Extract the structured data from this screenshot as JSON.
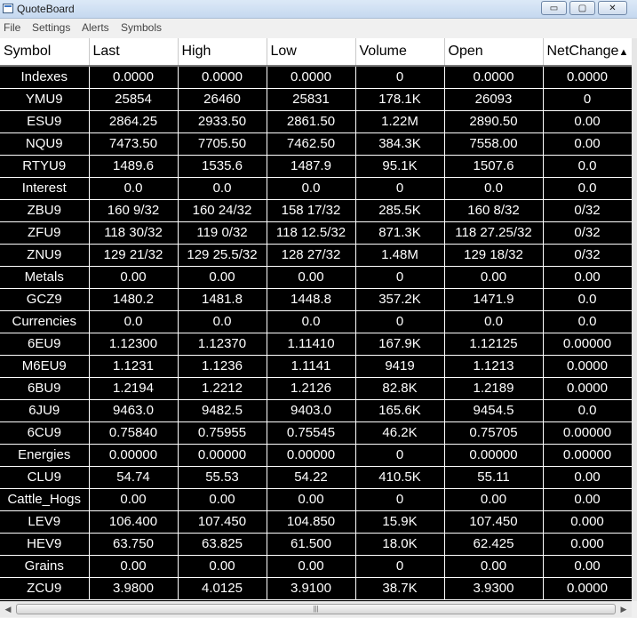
{
  "window": {
    "title": "QuoteBoard",
    "min_glyph": "▭",
    "max_glyph": "▢",
    "close_glyph": "✕"
  },
  "menu": [
    "File",
    "Settings",
    "Alerts",
    "Symbols"
  ],
  "table": {
    "columns": [
      "Symbol",
      "Last",
      "High",
      "Low",
      "Volume",
      "Open",
      "NetChange"
    ],
    "sort_indicator": "▲",
    "rows": [
      [
        "Indexes",
        "0.0000",
        "0.0000",
        "0.0000",
        "0",
        "0.0000",
        "0.0000"
      ],
      [
        "YMU9",
        "25854",
        "26460",
        "25831",
        "178.1K",
        "26093",
        "0"
      ],
      [
        "ESU9",
        "2864.25",
        "2933.50",
        "2861.50",
        "1.22M",
        "2890.50",
        "0.00"
      ],
      [
        "NQU9",
        "7473.50",
        "7705.50",
        "7462.50",
        "384.3K",
        "7558.00",
        "0.00"
      ],
      [
        "RTYU9",
        "1489.6",
        "1535.6",
        "1487.9",
        "95.1K",
        "1507.6",
        "0.0"
      ],
      [
        "Interest",
        "0.0",
        "0.0",
        "0.0",
        "0",
        "0.0",
        "0.0"
      ],
      [
        "ZBU9",
        "160 9/32",
        "160 24/32",
        "158 17/32",
        "285.5K",
        "160 8/32",
        "0/32"
      ],
      [
        "ZFU9",
        "118 30/32",
        "119 0/32",
        "118 12.5/32",
        "871.3K",
        "118 27.25/32",
        "0/32"
      ],
      [
        "ZNU9",
        "129 21/32",
        "129 25.5/32",
        "128 27/32",
        "1.48M",
        "129 18/32",
        "0/32"
      ],
      [
        "Metals",
        "0.00",
        "0.00",
        "0.00",
        "0",
        "0.00",
        "0.00"
      ],
      [
        "GCZ9",
        "1480.2",
        "1481.8",
        "1448.8",
        "357.2K",
        "1471.9",
        "0.0"
      ],
      [
        "Currencies",
        "0.0",
        "0.0",
        "0.0",
        "0",
        "0.0",
        "0.0"
      ],
      [
        "6EU9",
        "1.12300",
        "1.12370",
        "1.11410",
        "167.9K",
        "1.12125",
        "0.00000"
      ],
      [
        "M6EU9",
        "1.1231",
        "1.1236",
        "1.1141",
        "9419",
        "1.1213",
        "0.0000"
      ],
      [
        "6BU9",
        "1.2194",
        "1.2212",
        "1.2126",
        "82.8K",
        "1.2189",
        "0.0000"
      ],
      [
        "6JU9",
        "9463.0",
        "9482.5",
        "9403.0",
        "165.6K",
        "9454.5",
        "0.0"
      ],
      [
        "6CU9",
        "0.75840",
        "0.75955",
        "0.75545",
        "46.2K",
        "0.75705",
        "0.00000"
      ],
      [
        "Energies",
        "0.00000",
        "0.00000",
        "0.00000",
        "0",
        "0.00000",
        "0.00000"
      ],
      [
        "CLU9",
        "54.74",
        "55.53",
        "54.22",
        "410.5K",
        "55.11",
        "0.00"
      ],
      [
        "Cattle_Hogs",
        "0.00",
        "0.00",
        "0.00",
        "0",
        "0.00",
        "0.00"
      ],
      [
        "LEV9",
        "106.400",
        "107.450",
        "104.850",
        "15.9K",
        "107.450",
        "0.000"
      ],
      [
        "HEV9",
        "63.750",
        "63.825",
        "61.500",
        "18.0K",
        "62.425",
        "0.000"
      ],
      [
        "Grains",
        "0.00",
        "0.00",
        "0.00",
        "0",
        "0.00",
        "0.00"
      ],
      [
        "ZCU9",
        "3.9800",
        "4.0125",
        "3.9100",
        "38.7K",
        "3.9300",
        "0.0000"
      ]
    ]
  },
  "scrollbar": {
    "left_arrow": "◀",
    "right_arrow": "▶",
    "grip": "|||"
  }
}
